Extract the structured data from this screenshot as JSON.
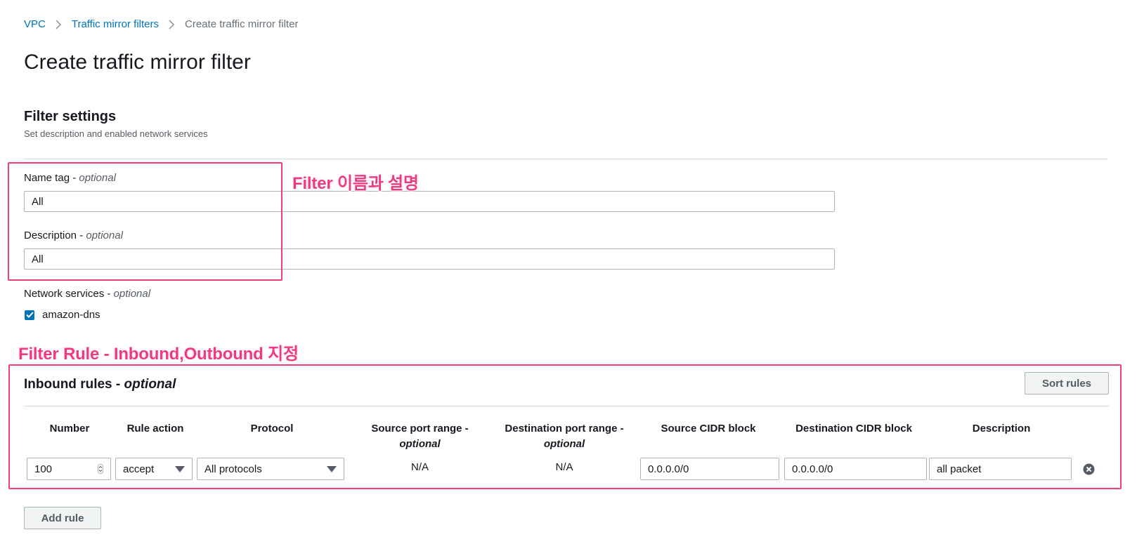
{
  "breadcrumb": {
    "items": [
      "VPC",
      "Traffic mirror filters"
    ],
    "current": "Create traffic mirror filter"
  },
  "page_title": "Create traffic mirror filter",
  "filter_settings": {
    "title": "Filter settings",
    "subtitle": "Set description and enabled network services",
    "name_tag": {
      "label": "Name tag - ",
      "optional": "optional",
      "value": "All"
    },
    "description": {
      "label": "Description - ",
      "optional": "optional",
      "value": "All"
    },
    "network_services": {
      "label": "Network services - ",
      "optional": "optional",
      "option": "amazon-dns",
      "checked": true
    }
  },
  "annotations": {
    "filter_name": "Filter 이름과 설명",
    "filter_rule": "Filter Rule - Inbound,Outbound 지정",
    "color": "#ec3f7e"
  },
  "inbound_rules": {
    "title": "Inbound rules - ",
    "optional": "optional",
    "sort_button": "Sort rules",
    "columns": {
      "number": "Number",
      "rule_action": "Rule action",
      "protocol": "Protocol",
      "source_port": "Source port range -",
      "source_port_opt": "optional",
      "dest_port": "Destination port range -",
      "dest_port_opt": "optional",
      "source_cidr": "Source CIDR block",
      "dest_cidr": "Destination CIDR block",
      "description": "Description"
    },
    "rows": [
      {
        "number": "100",
        "rule_action": "accept",
        "protocol": "All protocols",
        "source_port": "N/A",
        "dest_port": "N/A",
        "source_cidr": "0.0.0.0/0",
        "dest_cidr": "0.0.0.0/0",
        "description": "all packet"
      }
    ],
    "add_button": "Add rule"
  },
  "colors": {
    "link": "#0073bb",
    "accent": "#ec3f7e",
    "checkbox": "#0073bb"
  }
}
